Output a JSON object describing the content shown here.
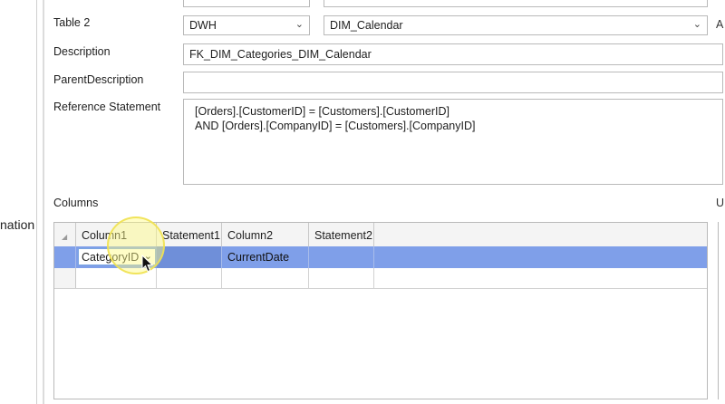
{
  "left_panel": {
    "partial_label": "nation"
  },
  "form": {
    "table2": {
      "label": "Table 2",
      "schema": "DWH",
      "table": "DIM_Calendar"
    },
    "description": {
      "label": "Description",
      "value": "FK_DIM_Categories_DIM_Calendar"
    },
    "parent_description": {
      "label": "ParentDescription",
      "value": ""
    },
    "reference_statement": {
      "label": "Reference Statement",
      "lines": [
        "[Orders].[CustomerID] = [Customers].[CustomerID]",
        "AND [Orders].[CompanyID] = [Customers].[CompanyID]"
      ]
    },
    "columns_label": "Columns",
    "right_cut_labels": {
      "a": "A",
      "u": "U"
    }
  },
  "grid": {
    "headers": [
      "Column1",
      "Statement1",
      "Column2",
      "Statement2"
    ],
    "rows": [
      {
        "column1": "CategoryID",
        "statement1": "",
        "column2": "CurrentDate",
        "statement2": ""
      }
    ]
  },
  "icons": {
    "dropdown": "chevron-down-icon",
    "cursor": "mouse-pointer-icon"
  },
  "colors": {
    "selected_row": "#7f9fe9",
    "highlight": "#fffa82"
  }
}
